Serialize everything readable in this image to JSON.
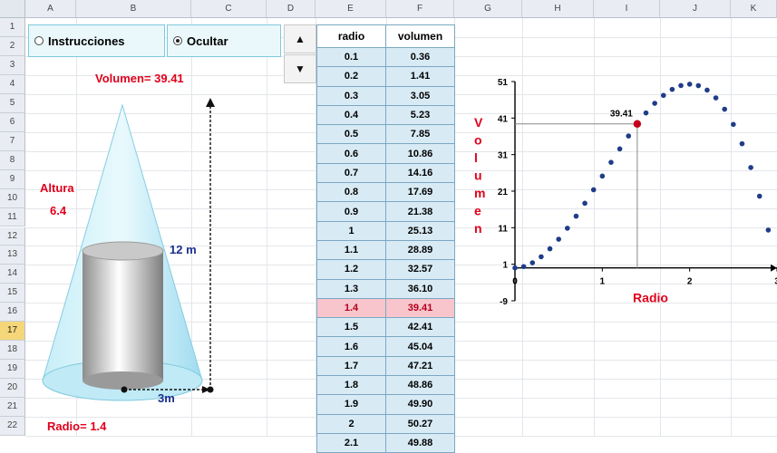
{
  "columns": [
    "A",
    "B",
    "C",
    "D",
    "E",
    "F",
    "G",
    "H",
    "I",
    "J",
    "K"
  ],
  "rows": [
    "1",
    "2",
    "3",
    "4",
    "5",
    "6",
    "7",
    "8",
    "9",
    "10",
    "11",
    "12",
    "13",
    "14",
    "15",
    "16",
    "17",
    "18",
    "19",
    "20",
    "21",
    "22"
  ],
  "selected_row": "17",
  "options": {
    "instrucciones_label": "Instrucciones",
    "ocultar_label": "Ocultar",
    "selected": "Ocultar"
  },
  "spinner": {
    "up_icon": "triangle-up-icon",
    "down_icon": "triangle-down-icon"
  },
  "diagram": {
    "volumen_label": "Volumen= 39.41",
    "altura_label": "Altura",
    "altura_value": "6.4",
    "height_label": "12 m",
    "radius_label": "3m",
    "radio_label": "Radio= 1.4"
  },
  "table": {
    "headers": [
      "radio",
      "volumen"
    ],
    "rows": [
      [
        "0.1",
        "0.36"
      ],
      [
        "0.2",
        "1.41"
      ],
      [
        "0.3",
        "3.05"
      ],
      [
        "0.4",
        "5.23"
      ],
      [
        "0.5",
        "7.85"
      ],
      [
        "0.6",
        "10.86"
      ],
      [
        "0.7",
        "14.16"
      ],
      [
        "0.8",
        "17.69"
      ],
      [
        "0.9",
        "21.38"
      ],
      [
        "1",
        "25.13"
      ],
      [
        "1.1",
        "28.89"
      ],
      [
        "1.2",
        "32.57"
      ],
      [
        "1.3",
        "36.10"
      ],
      [
        "1.4",
        "39.41"
      ],
      [
        "1.5",
        "42.41"
      ],
      [
        "1.6",
        "45.04"
      ],
      [
        "1.7",
        "47.21"
      ],
      [
        "1.8",
        "48.86"
      ],
      [
        "1.9",
        "49.90"
      ],
      [
        "2",
        "50.27"
      ],
      [
        "2.1",
        "49.88"
      ]
    ],
    "highlight_index": 13
  },
  "colors": {
    "accent_red": "#e0001b",
    "label_blue": "#1a2f8c",
    "cell_blue": "#d8ebf5",
    "highlight": "#f8c5cc",
    "point_blue": "#1f3c88"
  },
  "chart_data": {
    "type": "scatter",
    "xlabel": "Radio",
    "ylabel": "Volumen",
    "xlim": [
      0,
      3
    ],
    "ylim": [
      -9,
      51
    ],
    "y_ticks": [
      51,
      41,
      31,
      21,
      11,
      1,
      -9
    ],
    "x_ticks": [
      0,
      1,
      2,
      3
    ],
    "annotation": {
      "x": 1.4,
      "y": 39.41,
      "text": "39.41"
    },
    "series": [
      {
        "x": [
          0.1,
          0.2,
          0.3,
          0.4,
          0.5,
          0.6,
          0.7,
          0.8,
          0.9,
          1.0,
          1.1,
          1.2,
          1.3,
          1.5,
          1.6,
          1.7,
          1.8,
          1.9,
          2.0,
          2.1,
          2.2,
          2.3,
          2.4,
          2.5,
          2.6,
          2.7,
          2.8,
          2.9
        ],
        "y": [
          0.36,
          1.41,
          3.05,
          5.23,
          7.85,
          10.86,
          14.16,
          17.69,
          21.38,
          25.13,
          28.89,
          32.57,
          36.1,
          42.41,
          45.04,
          47.21,
          48.86,
          49.9,
          50.27,
          49.88,
          48.66,
          46.53,
          43.43,
          39.27,
          33.98,
          27.47,
          19.63,
          10.36
        ]
      }
    ]
  }
}
